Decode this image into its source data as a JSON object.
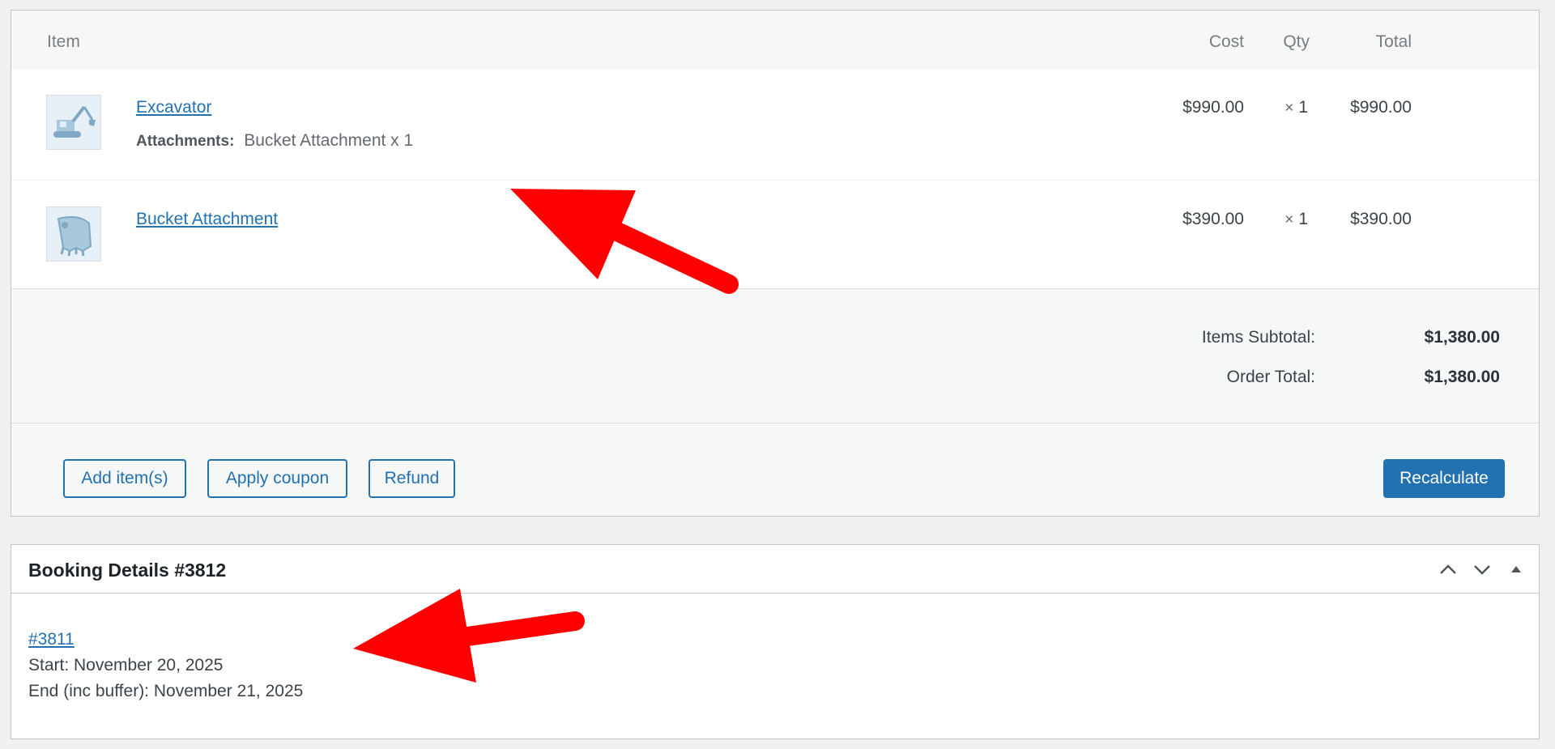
{
  "order_items": {
    "headers": {
      "item": "Item",
      "cost": "Cost",
      "qty": "Qty",
      "total": "Total"
    },
    "rows": [
      {
        "name": "Excavator",
        "meta_label": "Attachments:",
        "meta_value": "Bucket Attachment x 1",
        "cost": "$990.00",
        "qty_symbol": "×",
        "qty": "1",
        "total": "$990.00",
        "thumbnail_icon": "excavator-icon"
      },
      {
        "name": "Bucket Attachment",
        "cost": "$390.00",
        "qty_symbol": "×",
        "qty": "1",
        "total": "$390.00",
        "thumbnail_icon": "bucket-icon"
      }
    ],
    "totals": [
      {
        "label": "Items Subtotal:",
        "value": "$1,380.00"
      },
      {
        "label": "Order Total:",
        "value": "$1,380.00"
      }
    ],
    "actions": {
      "add_items": "Add item(s)",
      "apply_coupon": "Apply coupon",
      "refund": "Refund",
      "recalculate": "Recalculate"
    }
  },
  "booking": {
    "title": "Booking Details #3812",
    "link": "#3811",
    "start": "Start: November 20, 2025",
    "end": "End (inc buffer): November 21, 2025"
  },
  "colors": {
    "link": "#2271b1",
    "primary_button": "#2271b1",
    "annotation_arrow": "#ff0000"
  }
}
